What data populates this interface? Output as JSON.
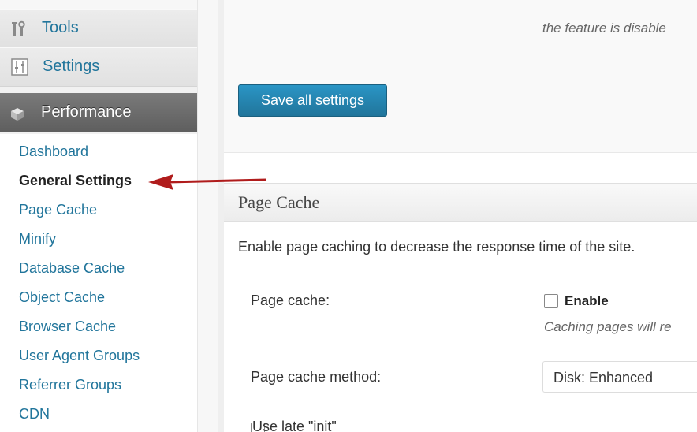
{
  "sidebar": {
    "tools_label": "Tools",
    "settings_label": "Settings",
    "performance_label": "Performance",
    "submenu": [
      "Dashboard",
      "General Settings",
      "Page Cache",
      "Minify",
      "Database Cache",
      "Object Cache",
      "Browser Cache",
      "User Agent Groups",
      "Referrer Groups",
      "CDN"
    ],
    "current_item": "General Settings"
  },
  "content": {
    "disabled_note": "the feature is disable",
    "save_button_label": "Save all settings",
    "page_cache_box": {
      "title": "Page Cache",
      "description": "Enable page caching to decrease the response time of the site.",
      "page_cache_label": "Page cache:",
      "enable_label": "Enable",
      "enable_checked": false,
      "enable_hint": "Caching pages will re",
      "method_label": "Page cache method:",
      "method_value": "Disk: Enhanced",
      "late_init_label": "Use late \"init\""
    }
  },
  "colors": {
    "link": "#21759b",
    "performance_bg": "#6d6d6d",
    "button_blue": "#21759b",
    "arrow_red": "#b01c1c"
  }
}
